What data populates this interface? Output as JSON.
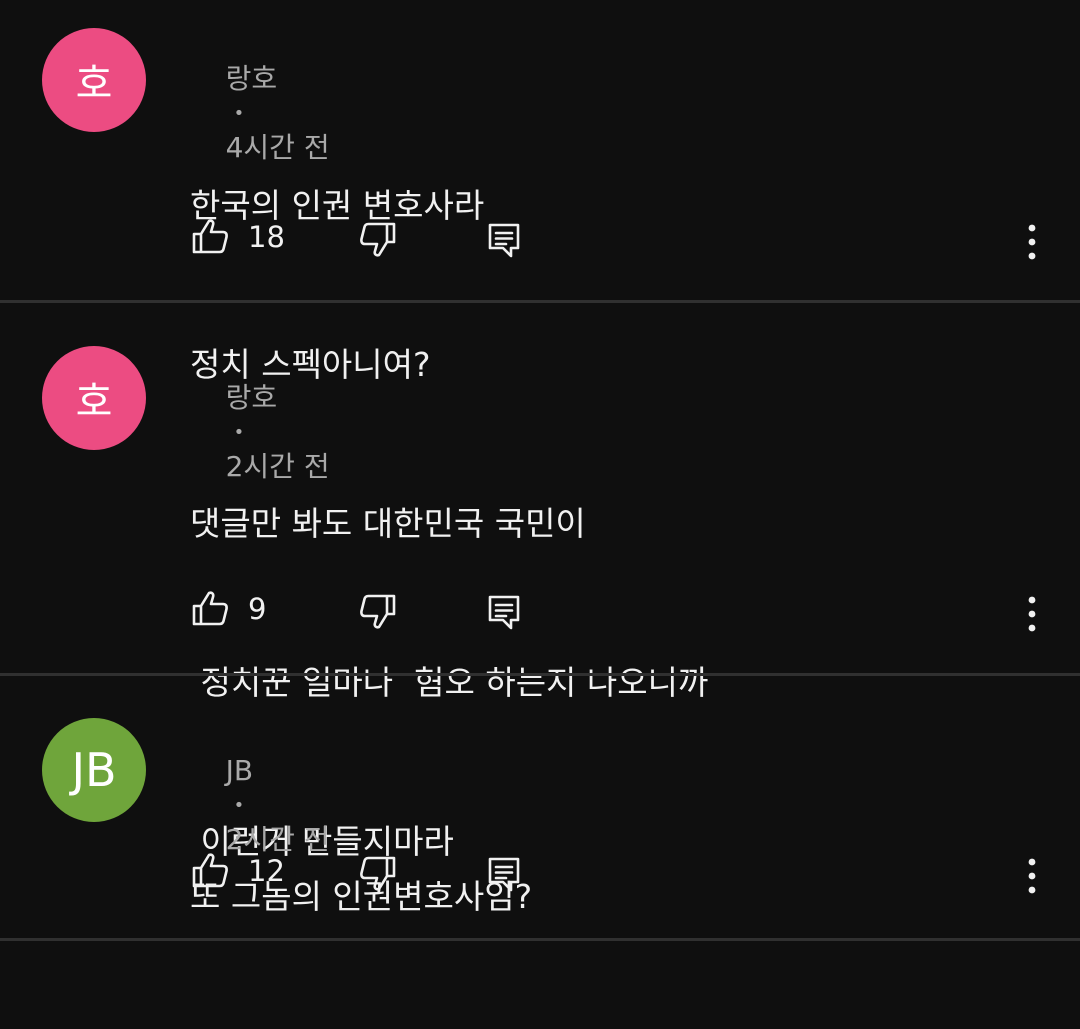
{
  "colors": {
    "background": "#0f0f0f",
    "avatar_pink": "#ec4c82",
    "avatar_green": "#6fa53b",
    "divider": "#303030",
    "meta_text": "#a9a9a9"
  },
  "comments": [
    {
      "avatar_letter": "호",
      "avatar_color": "#ec4c82",
      "author": "랑호",
      "separator": "•",
      "time": "4시간 전",
      "lines": [
        "한국의 인권 변호사라",
        "정치 스펙아니여?"
      ],
      "likes": "18",
      "icons": [
        "thumbs-up-icon",
        "thumbs-down-icon",
        "reply-icon",
        "more-vert-icon"
      ]
    },
    {
      "avatar_letter": "호",
      "avatar_color": "#ec4c82",
      "author": "랑호",
      "separator": "•",
      "time": "2시간 전",
      "lines": [
        "댓글만 봐도 대한민국 국민이",
        " 정치꾼 얼마나  혐오 하는지 나오니까",
        " 이런거 만들지마라"
      ],
      "likes": "9",
      "icons": [
        "thumbs-up-icon",
        "thumbs-down-icon",
        "reply-icon",
        "more-vert-icon"
      ]
    },
    {
      "avatar_letter": "JB",
      "avatar_color": "#6fa53b",
      "author": "JB",
      "separator": "•",
      "time": "2시간 전",
      "lines": [
        "또 그놈의 인권변호사임?"
      ],
      "likes": "12",
      "icons": [
        "thumbs-up-icon",
        "thumbs-down-icon",
        "reply-icon",
        "more-vert-icon"
      ]
    }
  ]
}
